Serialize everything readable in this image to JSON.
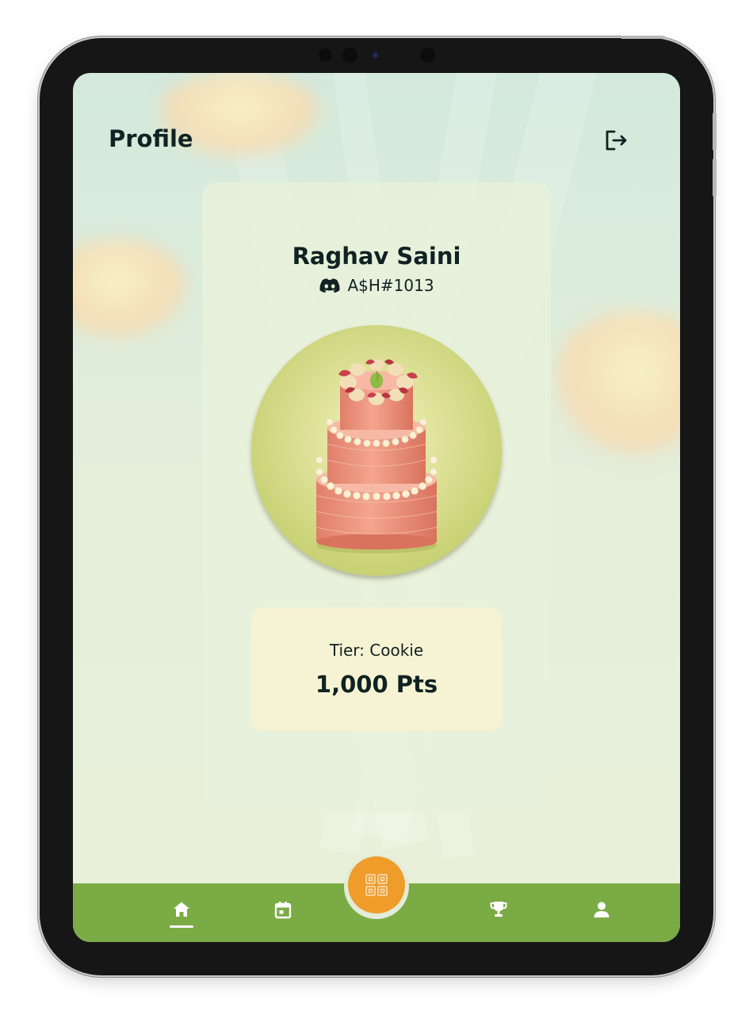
{
  "header": {
    "title": "Profile"
  },
  "profile": {
    "name": "Raghav Saini",
    "discord_handle": "A$H#1013"
  },
  "tier_card": {
    "tier": "Tier: Cookie",
    "points": "1,000 Pts"
  },
  "icons": {
    "logout": "logout-icon",
    "discord": "discord-icon",
    "home": "home-icon",
    "calendar": "calendar-icon",
    "scan": "qr-scan-icon",
    "trophy": "trophy-icon",
    "profile": "person-icon"
  },
  "colors": {
    "nav_bar": "#7aab45",
    "scan_button": "#ef9c2a",
    "text": "#102222",
    "tier_box": "#f6f3d4"
  },
  "nav": {
    "active": "home"
  }
}
